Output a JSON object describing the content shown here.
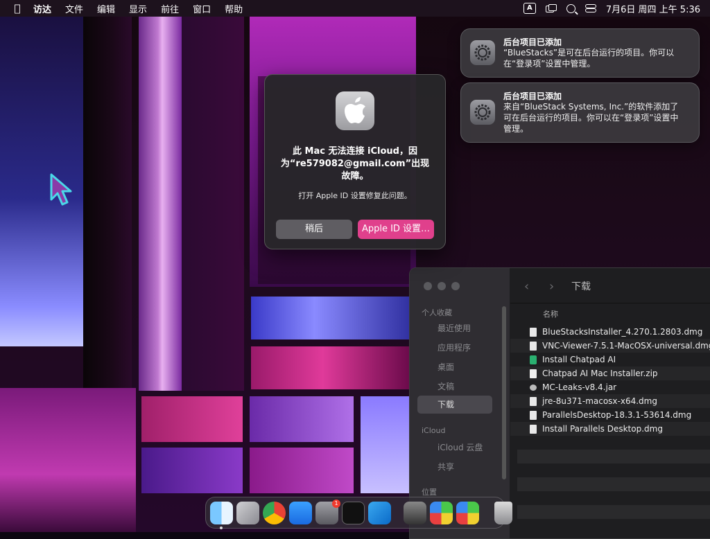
{
  "menubar": {
    "app_name": "访达",
    "items": [
      "文件",
      "编辑",
      "显示",
      "前往",
      "窗口",
      "帮助"
    ],
    "input_method": "A",
    "datetime": "7月6日 周四  上午 5:36"
  },
  "dialog": {
    "title": "此 Mac 无法连接 iCloud，因为“re579082@gmail.com”出现故障。",
    "message": "打开 Apple ID 设置修复此问题。",
    "later_button": "稍后",
    "settings_button": "Apple ID 设置…"
  },
  "notifications": [
    {
      "title": "后台项目已添加",
      "body": "“BlueStacks”是可在后台运行的项目。你可以在“登录项”设置中管理。"
    },
    {
      "title": "后台项目已添加",
      "body": "来自“BlueStack Systems, Inc.”的软件添加了可在后台运行的项目。你可以在“登录项”设置中管理。"
    }
  ],
  "finder": {
    "folder_title": "下载",
    "column_name": "名称",
    "sidebar": {
      "favorites_header": "个人收藏",
      "recent": "最近使用",
      "applications": "应用程序",
      "desktop": "桌面",
      "documents": "文稿",
      "downloads": "下载",
      "icloud_header": "iCloud",
      "icloud_drive": "iCloud 云盘",
      "shared": "共享",
      "locations_header": "位置"
    },
    "files": [
      {
        "name": "BlueStacksInstaller_4.270.1.2803.dmg",
        "icon": "disk-image-icon"
      },
      {
        "name": "VNC-Viewer-7.5.1-MacOSX-universal.dmg",
        "icon": "disk-image-icon"
      },
      {
        "name": "Install Chatpad AI",
        "icon": "app-icon"
      },
      {
        "name": "Chatpad AI Mac Installer.zip",
        "icon": "zip-icon"
      },
      {
        "name": "MC-Leaks-v8.4.jar",
        "icon": "java-icon"
      },
      {
        "name": "jre-8u371-macosx-x64.dmg",
        "icon": "disk-image-icon"
      },
      {
        "name": "ParallelsDesktop-18.3.1-53614.dmg",
        "icon": "disk-image-icon"
      },
      {
        "name": "Install Parallels Desktop.dmg",
        "icon": "disk-image-icon"
      }
    ]
  },
  "dock": {
    "apps": [
      "finder",
      "launchpad",
      "chrome",
      "app-store",
      "system-settings",
      "terminal",
      "vscode",
      "automator",
      "bluestacks",
      "bluestacks-multi",
      "trash"
    ],
    "settings_badge": "1"
  },
  "colors": {
    "accent": "#e0408c",
    "menubar_bg": "#1e141e",
    "dialog_bg": "#28262a"
  }
}
